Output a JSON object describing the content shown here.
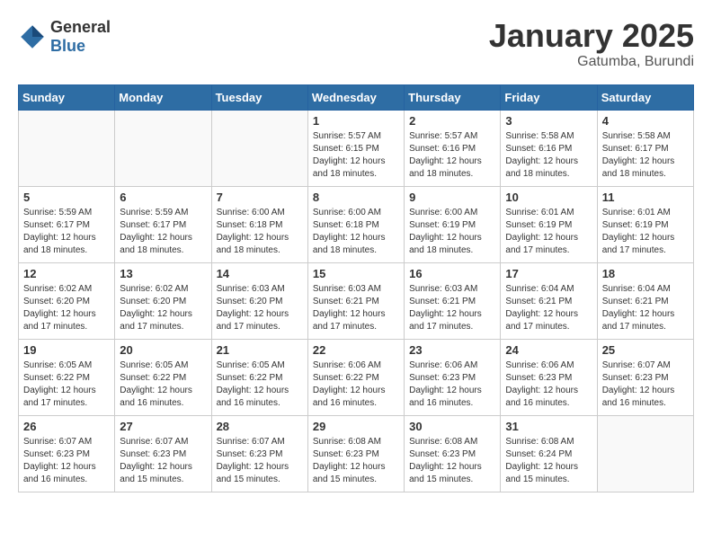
{
  "header": {
    "logo_general": "General",
    "logo_blue": "Blue",
    "month": "January 2025",
    "location": "Gatumba, Burundi"
  },
  "weekdays": [
    "Sunday",
    "Monday",
    "Tuesday",
    "Wednesday",
    "Thursday",
    "Friday",
    "Saturday"
  ],
  "weeks": [
    [
      {
        "day": "",
        "sunrise": "",
        "sunset": "",
        "daylight": ""
      },
      {
        "day": "",
        "sunrise": "",
        "sunset": "",
        "daylight": ""
      },
      {
        "day": "",
        "sunrise": "",
        "sunset": "",
        "daylight": ""
      },
      {
        "day": "1",
        "sunrise": "Sunrise: 5:57 AM",
        "sunset": "Sunset: 6:15 PM",
        "daylight": "Daylight: 12 hours and 18 minutes."
      },
      {
        "day": "2",
        "sunrise": "Sunrise: 5:57 AM",
        "sunset": "Sunset: 6:16 PM",
        "daylight": "Daylight: 12 hours and 18 minutes."
      },
      {
        "day": "3",
        "sunrise": "Sunrise: 5:58 AM",
        "sunset": "Sunset: 6:16 PM",
        "daylight": "Daylight: 12 hours and 18 minutes."
      },
      {
        "day": "4",
        "sunrise": "Sunrise: 5:58 AM",
        "sunset": "Sunset: 6:17 PM",
        "daylight": "Daylight: 12 hours and 18 minutes."
      }
    ],
    [
      {
        "day": "5",
        "sunrise": "Sunrise: 5:59 AM",
        "sunset": "Sunset: 6:17 PM",
        "daylight": "Daylight: 12 hours and 18 minutes."
      },
      {
        "day": "6",
        "sunrise": "Sunrise: 5:59 AM",
        "sunset": "Sunset: 6:17 PM",
        "daylight": "Daylight: 12 hours and 18 minutes."
      },
      {
        "day": "7",
        "sunrise": "Sunrise: 6:00 AM",
        "sunset": "Sunset: 6:18 PM",
        "daylight": "Daylight: 12 hours and 18 minutes."
      },
      {
        "day": "8",
        "sunrise": "Sunrise: 6:00 AM",
        "sunset": "Sunset: 6:18 PM",
        "daylight": "Daylight: 12 hours and 18 minutes."
      },
      {
        "day": "9",
        "sunrise": "Sunrise: 6:00 AM",
        "sunset": "Sunset: 6:19 PM",
        "daylight": "Daylight: 12 hours and 18 minutes."
      },
      {
        "day": "10",
        "sunrise": "Sunrise: 6:01 AM",
        "sunset": "Sunset: 6:19 PM",
        "daylight": "Daylight: 12 hours and 17 minutes."
      },
      {
        "day": "11",
        "sunrise": "Sunrise: 6:01 AM",
        "sunset": "Sunset: 6:19 PM",
        "daylight": "Daylight: 12 hours and 17 minutes."
      }
    ],
    [
      {
        "day": "12",
        "sunrise": "Sunrise: 6:02 AM",
        "sunset": "Sunset: 6:20 PM",
        "daylight": "Daylight: 12 hours and 17 minutes."
      },
      {
        "day": "13",
        "sunrise": "Sunrise: 6:02 AM",
        "sunset": "Sunset: 6:20 PM",
        "daylight": "Daylight: 12 hours and 17 minutes."
      },
      {
        "day": "14",
        "sunrise": "Sunrise: 6:03 AM",
        "sunset": "Sunset: 6:20 PM",
        "daylight": "Daylight: 12 hours and 17 minutes."
      },
      {
        "day": "15",
        "sunrise": "Sunrise: 6:03 AM",
        "sunset": "Sunset: 6:21 PM",
        "daylight": "Daylight: 12 hours and 17 minutes."
      },
      {
        "day": "16",
        "sunrise": "Sunrise: 6:03 AM",
        "sunset": "Sunset: 6:21 PM",
        "daylight": "Daylight: 12 hours and 17 minutes."
      },
      {
        "day": "17",
        "sunrise": "Sunrise: 6:04 AM",
        "sunset": "Sunset: 6:21 PM",
        "daylight": "Daylight: 12 hours and 17 minutes."
      },
      {
        "day": "18",
        "sunrise": "Sunrise: 6:04 AM",
        "sunset": "Sunset: 6:21 PM",
        "daylight": "Daylight: 12 hours and 17 minutes."
      }
    ],
    [
      {
        "day": "19",
        "sunrise": "Sunrise: 6:05 AM",
        "sunset": "Sunset: 6:22 PM",
        "daylight": "Daylight: 12 hours and 17 minutes."
      },
      {
        "day": "20",
        "sunrise": "Sunrise: 6:05 AM",
        "sunset": "Sunset: 6:22 PM",
        "daylight": "Daylight: 12 hours and 16 minutes."
      },
      {
        "day": "21",
        "sunrise": "Sunrise: 6:05 AM",
        "sunset": "Sunset: 6:22 PM",
        "daylight": "Daylight: 12 hours and 16 minutes."
      },
      {
        "day": "22",
        "sunrise": "Sunrise: 6:06 AM",
        "sunset": "Sunset: 6:22 PM",
        "daylight": "Daylight: 12 hours and 16 minutes."
      },
      {
        "day": "23",
        "sunrise": "Sunrise: 6:06 AM",
        "sunset": "Sunset: 6:23 PM",
        "daylight": "Daylight: 12 hours and 16 minutes."
      },
      {
        "day": "24",
        "sunrise": "Sunrise: 6:06 AM",
        "sunset": "Sunset: 6:23 PM",
        "daylight": "Daylight: 12 hours and 16 minutes."
      },
      {
        "day": "25",
        "sunrise": "Sunrise: 6:07 AM",
        "sunset": "Sunset: 6:23 PM",
        "daylight": "Daylight: 12 hours and 16 minutes."
      }
    ],
    [
      {
        "day": "26",
        "sunrise": "Sunrise: 6:07 AM",
        "sunset": "Sunset: 6:23 PM",
        "daylight": "Daylight: 12 hours and 16 minutes."
      },
      {
        "day": "27",
        "sunrise": "Sunrise: 6:07 AM",
        "sunset": "Sunset: 6:23 PM",
        "daylight": "Daylight: 12 hours and 15 minutes."
      },
      {
        "day": "28",
        "sunrise": "Sunrise: 6:07 AM",
        "sunset": "Sunset: 6:23 PM",
        "daylight": "Daylight: 12 hours and 15 minutes."
      },
      {
        "day": "29",
        "sunrise": "Sunrise: 6:08 AM",
        "sunset": "Sunset: 6:23 PM",
        "daylight": "Daylight: 12 hours and 15 minutes."
      },
      {
        "day": "30",
        "sunrise": "Sunrise: 6:08 AM",
        "sunset": "Sunset: 6:23 PM",
        "daylight": "Daylight: 12 hours and 15 minutes."
      },
      {
        "day": "31",
        "sunrise": "Sunrise: 6:08 AM",
        "sunset": "Sunset: 6:24 PM",
        "daylight": "Daylight: 12 hours and 15 minutes."
      },
      {
        "day": "",
        "sunrise": "",
        "sunset": "",
        "daylight": ""
      }
    ]
  ]
}
